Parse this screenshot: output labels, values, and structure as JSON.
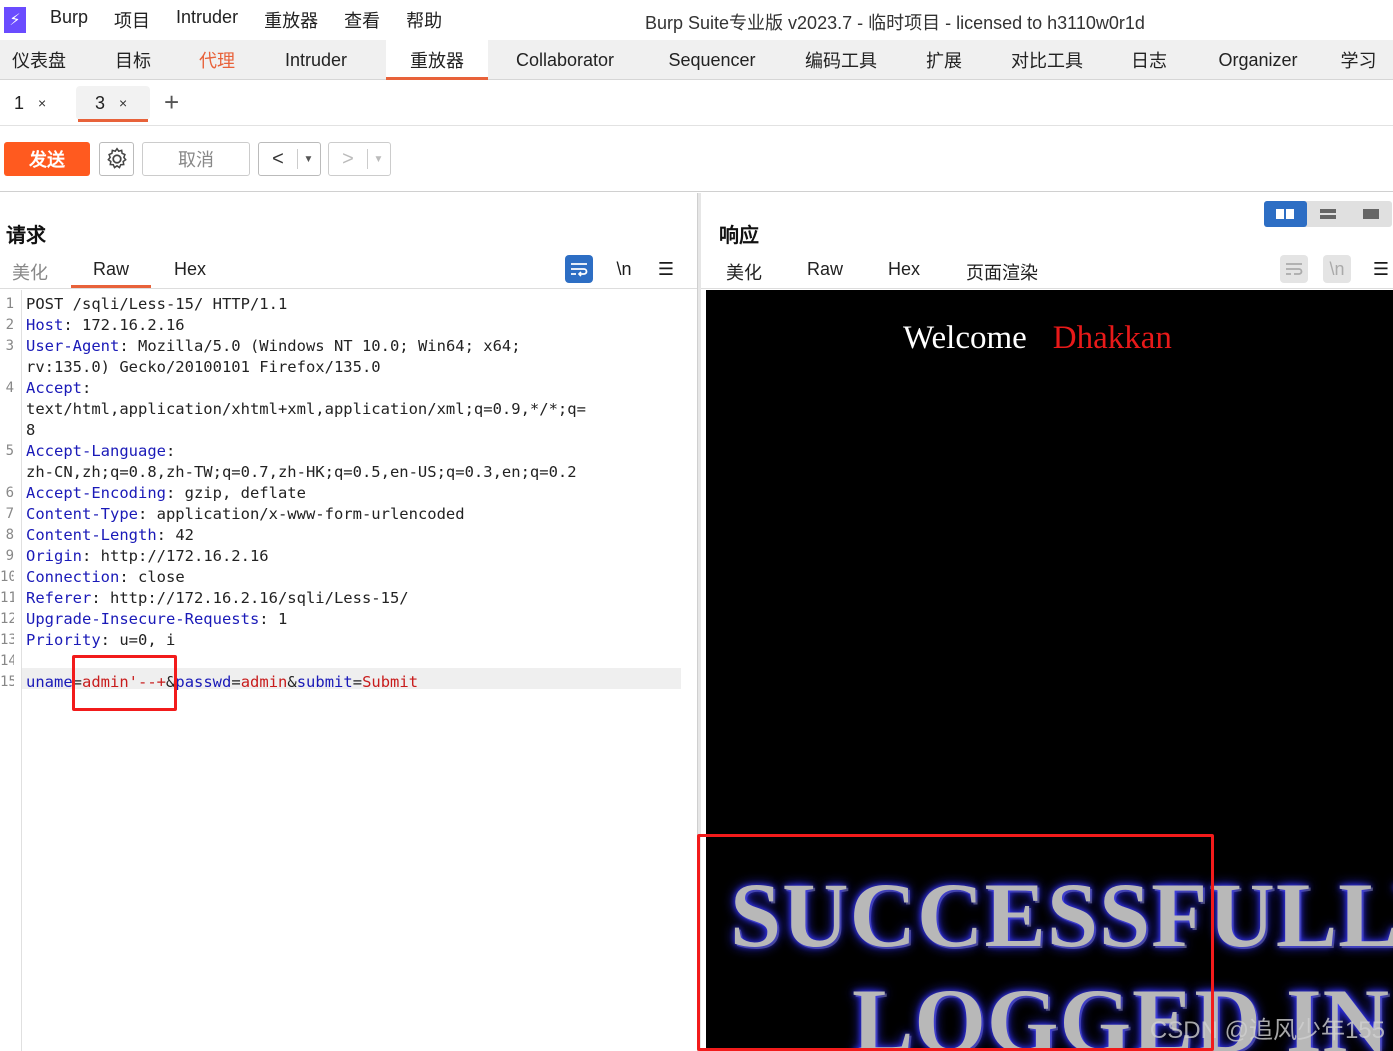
{
  "window": {
    "title": "Burp Suite专业版  v2023.7 - 临时项目 - licensed to h3110w0r1d",
    "menu": [
      "Burp",
      "项目",
      "Intruder",
      "重放器",
      "查看",
      "帮助"
    ]
  },
  "main_tabs": [
    "仪表盘",
    "目标",
    "代理",
    "Intruder",
    "重放器",
    "Collaborator",
    "Sequencer",
    "编码工具",
    "扩展",
    "对比工具",
    "日志",
    "Organizer",
    "学习"
  ],
  "sub_tabs": [
    {
      "label": "1",
      "close": "×"
    },
    {
      "label": "3",
      "close": "×"
    }
  ],
  "add_tab": "+",
  "toolbar": {
    "send": "发送",
    "cancel": "取消",
    "prev": "<",
    "next": ">",
    "dropdown": "▼"
  },
  "request": {
    "title": "请求",
    "tabs": [
      "美化",
      "Raw",
      "Hex"
    ],
    "active_tab": "Raw",
    "newline_icon": "\\n",
    "menu_icon": "☰",
    "lines": [
      {
        "n": "1",
        "parts": [
          [
            "t",
            "POST /sqli/Less-15/ HTTP/1.1"
          ]
        ]
      },
      {
        "n": "2",
        "parts": [
          [
            "k",
            "Host"
          ],
          [
            "t",
            ": 172.16.2.16"
          ]
        ]
      },
      {
        "n": "3",
        "parts": [
          [
            "k",
            "User-Agent"
          ],
          [
            "t",
            ": Mozilla/5.0 (Windows NT 10.0; Win64; x64;"
          ]
        ]
      },
      {
        "n": "",
        "parts": [
          [
            "t",
            "rv:135.0) Gecko/20100101 Firefox/135.0"
          ]
        ]
      },
      {
        "n": "4",
        "parts": [
          [
            "k",
            "Accept"
          ],
          [
            "t",
            ":"
          ]
        ]
      },
      {
        "n": "",
        "parts": [
          [
            "t",
            "text/html,application/xhtml+xml,application/xml;q=0.9,*/*;q="
          ]
        ]
      },
      {
        "n": "",
        "parts": [
          [
            "t",
            "8"
          ]
        ]
      },
      {
        "n": "5",
        "parts": [
          [
            "k",
            "Accept-Language"
          ],
          [
            "t",
            ":"
          ]
        ]
      },
      {
        "n": "",
        "parts": [
          [
            "t",
            "zh-CN,zh;q=0.8,zh-TW;q=0.7,zh-HK;q=0.5,en-US;q=0.3,en;q=0.2"
          ]
        ]
      },
      {
        "n": "6",
        "parts": [
          [
            "k",
            "Accept-Encoding"
          ],
          [
            "t",
            ": gzip, deflate"
          ]
        ]
      },
      {
        "n": "7",
        "parts": [
          [
            "k",
            "Content-Type"
          ],
          [
            "t",
            ": application/x-www-form-urlencoded"
          ]
        ]
      },
      {
        "n": "8",
        "parts": [
          [
            "k",
            "Content-Length"
          ],
          [
            "t",
            ": 42"
          ]
        ]
      },
      {
        "n": "9",
        "parts": [
          [
            "k",
            "Origin"
          ],
          [
            "t",
            ": http://172.16.2.16"
          ]
        ]
      },
      {
        "n": "10",
        "parts": [
          [
            "k",
            "Connection"
          ],
          [
            "t",
            ": close"
          ]
        ]
      },
      {
        "n": "11",
        "parts": [
          [
            "k",
            "Referer"
          ],
          [
            "t",
            ": http://172.16.2.16/sqli/Less-15/"
          ]
        ]
      },
      {
        "n": "12",
        "parts": [
          [
            "k",
            "Upgrade-Insecure-Requests"
          ],
          [
            "t",
            ": 1"
          ]
        ]
      },
      {
        "n": "13",
        "parts": [
          [
            "k",
            "Priority"
          ],
          [
            "t",
            ": u=0, i"
          ]
        ]
      },
      {
        "n": "14",
        "parts": []
      },
      {
        "n": "15",
        "parts": [
          [
            "k",
            "uname"
          ],
          [
            "t",
            "="
          ],
          [
            "v",
            "admin'--+"
          ],
          [
            "t",
            "&"
          ],
          [
            "k",
            "passwd"
          ],
          [
            "t",
            "="
          ],
          [
            "v",
            "admin"
          ],
          [
            "t",
            "&"
          ],
          [
            "k",
            "submit"
          ],
          [
            "t",
            "="
          ],
          [
            "v",
            "Submit"
          ]
        ]
      }
    ]
  },
  "response": {
    "title": "响应",
    "tabs": [
      "美化",
      "Raw",
      "Hex",
      "页面渲染"
    ],
    "active_tab": "页面渲染",
    "newline_icon": "\\n",
    "menu_icon": "☰",
    "render": {
      "welcome": "Welcome",
      "user": "Dhakkan",
      "line1": "SUCCESSFULLY",
      "line2": "LOGGED IN",
      "watermark": "CSDN @追风少年155"
    }
  },
  "colors": {
    "accent": "#e8623a",
    "send_button": "#ff5a1f",
    "header_key": "#1a1ab8",
    "param_value": "#c81c1c",
    "annotation": "#f21b1b",
    "toggle_blue": "#2d6ec4"
  }
}
